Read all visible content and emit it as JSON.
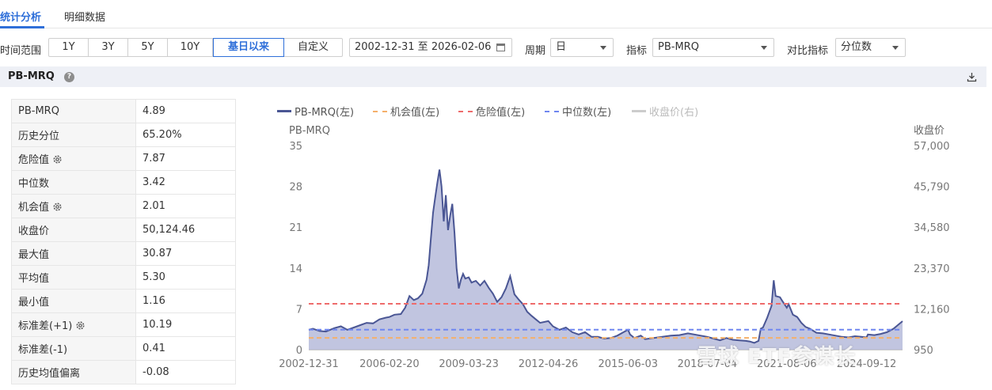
{
  "tabs": [
    {
      "label": "统计分析",
      "active": true
    },
    {
      "label": "明细数据",
      "active": false
    }
  ],
  "toolbar": {
    "time_range_label": "时间范围",
    "ranges": [
      {
        "label": "1Y",
        "active": false
      },
      {
        "label": "3Y",
        "active": false
      },
      {
        "label": "5Y",
        "active": false
      },
      {
        "label": "10Y",
        "active": false
      },
      {
        "label": "基日以来",
        "active": true
      },
      {
        "label": "自定义",
        "active": false
      }
    ],
    "date_range": "2002-12-31  至  2026-02-06",
    "period_label": "周期",
    "period_value": "日",
    "indicator_label": "指标",
    "indicator_value": "PB-MRQ",
    "compare_label": "对比指标",
    "compare_value": "分位数"
  },
  "section": {
    "title": "PB-MRQ"
  },
  "stats": [
    {
      "label": "PB-MRQ",
      "value": "4.89",
      "gear": false
    },
    {
      "label": "历史分位",
      "value": "65.20%",
      "gear": false
    },
    {
      "label": "危险值",
      "value": "7.87",
      "gear": true
    },
    {
      "label": "中位数",
      "value": "3.42",
      "gear": false
    },
    {
      "label": "机会值",
      "value": "2.01",
      "gear": true
    },
    {
      "label": "收盘价",
      "value": "50,124.46",
      "gear": false
    },
    {
      "label": "最大值",
      "value": "30.87",
      "gear": false
    },
    {
      "label": "平均值",
      "value": "5.30",
      "gear": false
    },
    {
      "label": "最小值",
      "value": "1.16",
      "gear": false
    },
    {
      "label": "标准差(+1)",
      "value": "10.19",
      "gear": true
    },
    {
      "label": "标准差(-1)",
      "value": "0.41",
      "gear": false
    },
    {
      "label": "历史均值偏离",
      "value": "-0.08",
      "gear": false
    }
  ],
  "watermark": "雪球 ETF参谋长",
  "chart_data": {
    "type": "area",
    "legend": [
      {
        "name": "PB-MRQ(左)",
        "color": "#4a5694",
        "style": "solid",
        "enabled": true
      },
      {
        "name": "机会值(左)",
        "color": "#f5b06a",
        "style": "dashed",
        "enabled": true
      },
      {
        "name": "危险值(左)",
        "color": "#ee6b6b",
        "style": "dashed",
        "enabled": true
      },
      {
        "name": "中位数(左)",
        "color": "#6f86f0",
        "style": "dashed",
        "enabled": true
      },
      {
        "name": "收盘价(右)",
        "color": "#cccccc",
        "style": "solid",
        "enabled": false
      }
    ],
    "y_left": {
      "label": "PB-MRQ",
      "ticks": [
        "0",
        "7",
        "14",
        "21",
        "28",
        "35"
      ],
      "min": 0,
      "max": 35
    },
    "y_right": {
      "label": "收盘价",
      "ticks": [
        "950",
        "12,160",
        "23,370",
        "34,580",
        "45,790",
        "57,000"
      ]
    },
    "x_ticks": [
      "2002-12-31",
      "2006-02-20",
      "2009-03-23",
      "2012-04-26",
      "2015-06-03",
      "2018-07-04",
      "2021-08-06",
      "2024-09-12"
    ],
    "x_range": [
      "2002-12-31",
      "2026-02-06"
    ],
    "reference_lines": {
      "danger": 7.87,
      "median": 3.42,
      "opportunity": 2.01
    },
    "series": [
      {
        "name": "PB-MRQ(左)",
        "points": [
          [
            "2002-12-31",
            3.4
          ],
          [
            "2003-03-01",
            3.6
          ],
          [
            "2003-06-01",
            3.2
          ],
          [
            "2003-09-01",
            3.1
          ],
          [
            "2004-01-01",
            3.7
          ],
          [
            "2004-04-01",
            4.0
          ],
          [
            "2004-07-01",
            3.4
          ],
          [
            "2004-10-01",
            3.8
          ],
          [
            "2005-01-01",
            4.2
          ],
          [
            "2005-04-01",
            4.6
          ],
          [
            "2005-07-01",
            4.5
          ],
          [
            "2005-10-01",
            5.2
          ],
          [
            "2006-01-01",
            5.5
          ],
          [
            "2006-02-20",
            5.6
          ],
          [
            "2006-05-01",
            6.0
          ],
          [
            "2006-08-01",
            6.1
          ],
          [
            "2006-10-01",
            7.2
          ],
          [
            "2006-12-01",
            9.2
          ],
          [
            "2007-02-01",
            8.5
          ],
          [
            "2007-04-01",
            8.8
          ],
          [
            "2007-06-01",
            9.6
          ],
          [
            "2007-08-01",
            12.0
          ],
          [
            "2007-09-01",
            14.5
          ],
          [
            "2007-10-01",
            19.0
          ],
          [
            "2007-11-01",
            23.5
          ],
          [
            "2007-12-01",
            26.0
          ],
          [
            "2008-01-01",
            28.6
          ],
          [
            "2008-02-01",
            30.87
          ],
          [
            "2008-03-01",
            28.0
          ],
          [
            "2008-04-01",
            22.0
          ],
          [
            "2008-05-01",
            26.5
          ],
          [
            "2008-06-01",
            20.5
          ],
          [
            "2008-07-01",
            23.0
          ],
          [
            "2008-08-01",
            25.0
          ],
          [
            "2008-09-01",
            20.0
          ],
          [
            "2008-10-01",
            14.0
          ],
          [
            "2008-11-01",
            10.5
          ],
          [
            "2008-12-01",
            12.0
          ],
          [
            "2009-01-01",
            13.0
          ],
          [
            "2009-02-01",
            12.2
          ],
          [
            "2009-03-23",
            12.4
          ],
          [
            "2009-05-01",
            11.5
          ],
          [
            "2009-07-01",
            11.8
          ],
          [
            "2009-09-01",
            11.0
          ],
          [
            "2009-11-01",
            11.8
          ],
          [
            "2010-01-01",
            10.6
          ],
          [
            "2010-03-01",
            9.6
          ],
          [
            "2010-05-01",
            8.2
          ],
          [
            "2010-07-01",
            9.0
          ],
          [
            "2010-09-01",
            10.5
          ],
          [
            "2010-11-01",
            12.6
          ],
          [
            "2011-01-01",
            9.5
          ],
          [
            "2011-03-01",
            8.6
          ],
          [
            "2011-05-01",
            7.8
          ],
          [
            "2011-07-01",
            6.5
          ],
          [
            "2011-09-01",
            5.8
          ],
          [
            "2011-11-01",
            5.2
          ],
          [
            "2012-01-01",
            4.6
          ],
          [
            "2012-04-26",
            4.9
          ],
          [
            "2012-07-01",
            4.0
          ],
          [
            "2012-10-01",
            3.4
          ],
          [
            "2013-01-01",
            3.8
          ],
          [
            "2013-04-01",
            3.0
          ],
          [
            "2013-07-01",
            2.6
          ],
          [
            "2013-10-01",
            3.0
          ],
          [
            "2014-01-01",
            2.2
          ],
          [
            "2014-04-01",
            2.2
          ],
          [
            "2014-07-01",
            1.9
          ],
          [
            "2014-10-01",
            2.0
          ],
          [
            "2015-01-01",
            2.4
          ],
          [
            "2015-03-01",
            2.8
          ],
          [
            "2015-05-01",
            3.2
          ],
          [
            "2015-06-03",
            3.4
          ],
          [
            "2015-07-01",
            2.6
          ],
          [
            "2015-09-01",
            2.0
          ],
          [
            "2015-12-01",
            2.4
          ],
          [
            "2016-02-01",
            1.8
          ],
          [
            "2016-06-01",
            2.0
          ],
          [
            "2016-10-01",
            2.2
          ],
          [
            "2017-02-01",
            2.4
          ],
          [
            "2017-06-01",
            2.5
          ],
          [
            "2017-10-01",
            2.8
          ],
          [
            "2018-01-01",
            2.6
          ],
          [
            "2018-04-01",
            2.4
          ],
          [
            "2018-07-04",
            2.2
          ],
          [
            "2018-10-01",
            1.9
          ],
          [
            "2019-01-01",
            1.6
          ],
          [
            "2019-04-01",
            2.0
          ],
          [
            "2019-07-01",
            1.7
          ],
          [
            "2019-10-01",
            1.6
          ],
          [
            "2020-01-01",
            1.5
          ],
          [
            "2020-03-01",
            1.4
          ],
          [
            "2020-05-01",
            1.16
          ],
          [
            "2020-07-01",
            1.5
          ],
          [
            "2020-08-01",
            3.6
          ],
          [
            "2020-09-01",
            3.8
          ],
          [
            "2020-11-01",
            5.5
          ],
          [
            "2021-01-01",
            7.5
          ],
          [
            "2021-02-01",
            11.9
          ],
          [
            "2021-03-01",
            9.2
          ],
          [
            "2021-05-01",
            9.0
          ],
          [
            "2021-06-01",
            8.4
          ],
          [
            "2021-08-06",
            7.2
          ],
          [
            "2021-09-01",
            7.8
          ],
          [
            "2021-11-01",
            6.0
          ],
          [
            "2022-01-01",
            5.6
          ],
          [
            "2022-03-01",
            4.6
          ],
          [
            "2022-05-01",
            3.9
          ],
          [
            "2022-07-01",
            3.6
          ],
          [
            "2022-10-01",
            2.9
          ],
          [
            "2023-01-01",
            2.8
          ],
          [
            "2023-04-01",
            2.6
          ],
          [
            "2023-07-01",
            2.4
          ],
          [
            "2023-10-01",
            2.2
          ],
          [
            "2024-01-01",
            2.1
          ],
          [
            "2024-04-01",
            2.3
          ],
          [
            "2024-07-01",
            2.2
          ],
          [
            "2024-09-12",
            2.1
          ],
          [
            "2024-10-01",
            2.6
          ],
          [
            "2025-01-01",
            2.5
          ],
          [
            "2025-04-01",
            2.7
          ],
          [
            "2025-07-01",
            3.0
          ],
          [
            "2025-10-01",
            3.6
          ],
          [
            "2025-12-01",
            4.2
          ],
          [
            "2026-02-06",
            4.89
          ]
        ]
      }
    ]
  }
}
